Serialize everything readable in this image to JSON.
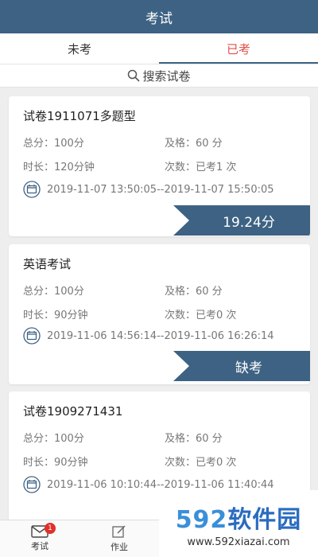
{
  "header": {
    "title": "考试"
  },
  "tabs": [
    {
      "label": "未考",
      "active": false
    },
    {
      "label": "已考",
      "active": true
    }
  ],
  "search": {
    "placeholder": "搜索试卷"
  },
  "exams": [
    {
      "title": "试卷1911071多题型",
      "total": "总分：100分",
      "pass": "及格：60 分",
      "duration": "时长：120分钟",
      "count": "次数：已考1 次",
      "time": "2019-11-07 13:50:05--2019-11-07 15:50:05",
      "result": "19.24分"
    },
    {
      "title": "英语考试",
      "total": "总分：100分",
      "pass": "及格：60 分",
      "duration": "时长：90分钟",
      "count": "次数：已考0 次",
      "time": "2019-11-06 14:56:14--2019-11-06 16:26:14",
      "result": "缺考"
    },
    {
      "title": "试卷1909271431",
      "total": "总分：100分",
      "pass": "及格：60 分",
      "duration": "时长：90分钟",
      "count": "次数：已考0 次",
      "time": "2019-11-06 10:10:44--2019-11-06 11:40:44",
      "result": ""
    }
  ],
  "bottom_nav": [
    {
      "label": "考试",
      "icon": "mail-icon",
      "badge": "1"
    },
    {
      "label": "作业",
      "icon": "edit-icon"
    }
  ],
  "watermark": {
    "logo_num": "592",
    "logo_cn": "软件园",
    "url": "www.592xiazai.com"
  },
  "colors": {
    "primary": "#3d6283",
    "accent": "#e0504a",
    "badge": "#e0302a"
  }
}
